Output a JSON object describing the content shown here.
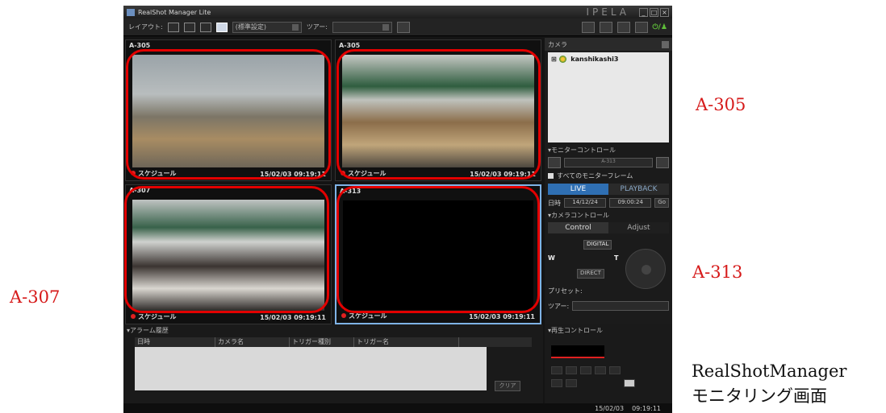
{
  "window": {
    "title": "RealShot Manager Lite",
    "brand": "IPELA"
  },
  "toolbar": {
    "layout_label": "レイアウト:",
    "profile_value": "(標準設定)",
    "tour_label": "ツアー:",
    "tour_value": ""
  },
  "cameras": [
    {
      "name": "A-305",
      "schedule": "スケジュール",
      "timestamp": "15/02/03 09:19:11"
    },
    {
      "name": "A-305",
      "schedule": "スケジュール",
      "timestamp": "15/02/03 09:19:11"
    },
    {
      "name": "A-307",
      "schedule": "スケジュール",
      "timestamp": "15/02/03 09:19:11"
    },
    {
      "name": "A-313",
      "schedule": "スケジュール",
      "timestamp": "15/02/03 09:19:11"
    }
  ],
  "sidebar": {
    "camera_header": "カメラ",
    "camera_tree_item": "kanshikashi3",
    "monitor_control": "モニターコントロール",
    "monitor_camera": "A-313",
    "all_frames": "すべてのモニターフレーム",
    "live_tab": "LIVE",
    "playback_tab": "PLAYBACK",
    "date_label": "日時",
    "date_value": "14/12/24",
    "time_value": "09:00:24",
    "go_button": "Go",
    "camera_control": "カメラコントロール",
    "control_tab": "Control",
    "adjust_tab": "Adjust",
    "digital_label": "DIGITAL",
    "zoom_wide": "W",
    "zoom_tele": "T",
    "direct_label": "DIRECT",
    "preset_label": "プリセット:",
    "tour_label": "ツアー:"
  },
  "alarm": {
    "header": "アラーム履歴",
    "columns": [
      "日時",
      "カメラ名",
      "トリガー種別",
      "トリガー名"
    ],
    "clear_button": "クリア"
  },
  "playback": {
    "header": "再生コントロール"
  },
  "status": {
    "date": "15/02/03",
    "time": "09:19:11",
    "alert": ""
  },
  "annotations": {
    "a305": "A-305",
    "a313": "A-313",
    "a307": "A-307",
    "caption_line1": "RealShotManager",
    "caption_line2": "モニタリング画面"
  },
  "colors": {
    "highlight": "#e30000",
    "live_tab": "#2f6fb3",
    "background": "#141414"
  }
}
